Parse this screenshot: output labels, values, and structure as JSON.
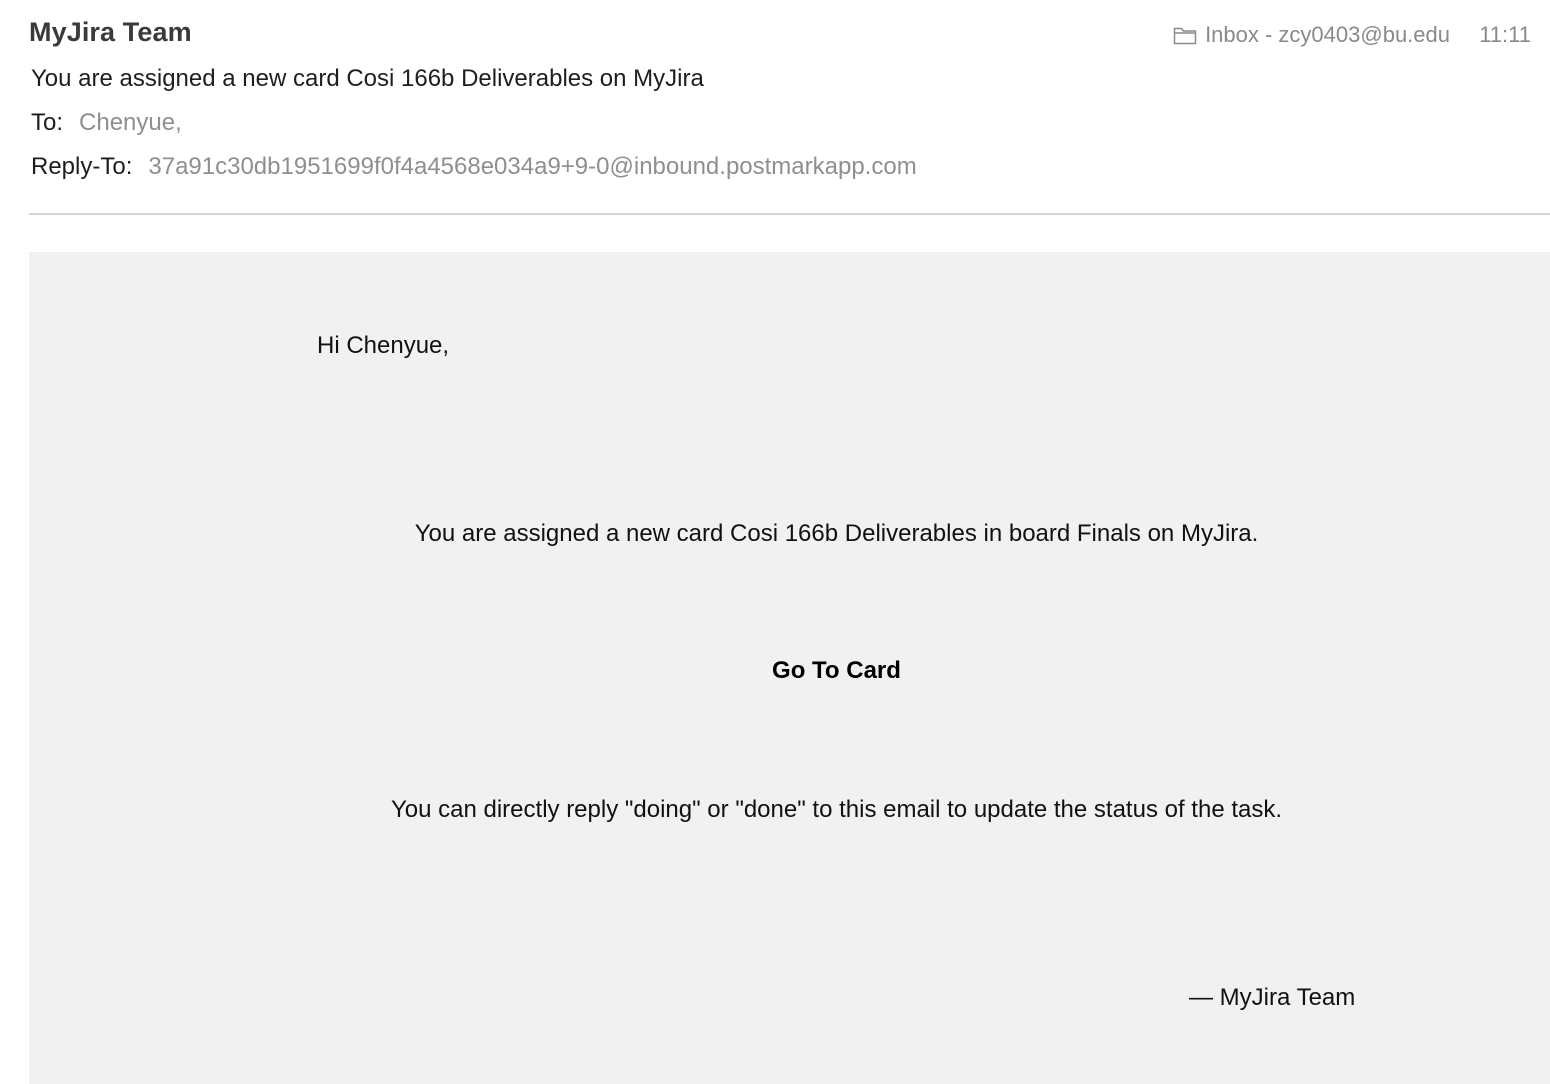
{
  "header": {
    "sender": "MyJira Team",
    "mailbox_label": "Inbox - zcy0403@bu.edu",
    "time": "11:11",
    "subject": "You are assigned a new card Cosi 166b Deliverables on MyJira",
    "to_label": "To:",
    "to_value": "Chenyue,",
    "reply_to_label": "Reply-To:",
    "reply_to_value": "37a91c30db1951699f0f4a4568e034a9+9-0@inbound.postmarkapp.com"
  },
  "body": {
    "greeting": "Hi Chenyue,",
    "message": "You are assigned a new card Cosi 166b Deliverables in board Finals on MyJira.",
    "cta_label": "Go To Card",
    "note": "You can directly reply \"doing\" or \"done\" to this email to update the status of the task.",
    "signature": "— MyJira Team"
  },
  "icons": {
    "mailbox": "folder-icon"
  },
  "colors": {
    "body_background": "#f1f1f1",
    "muted_text": "#8f8f8f"
  }
}
